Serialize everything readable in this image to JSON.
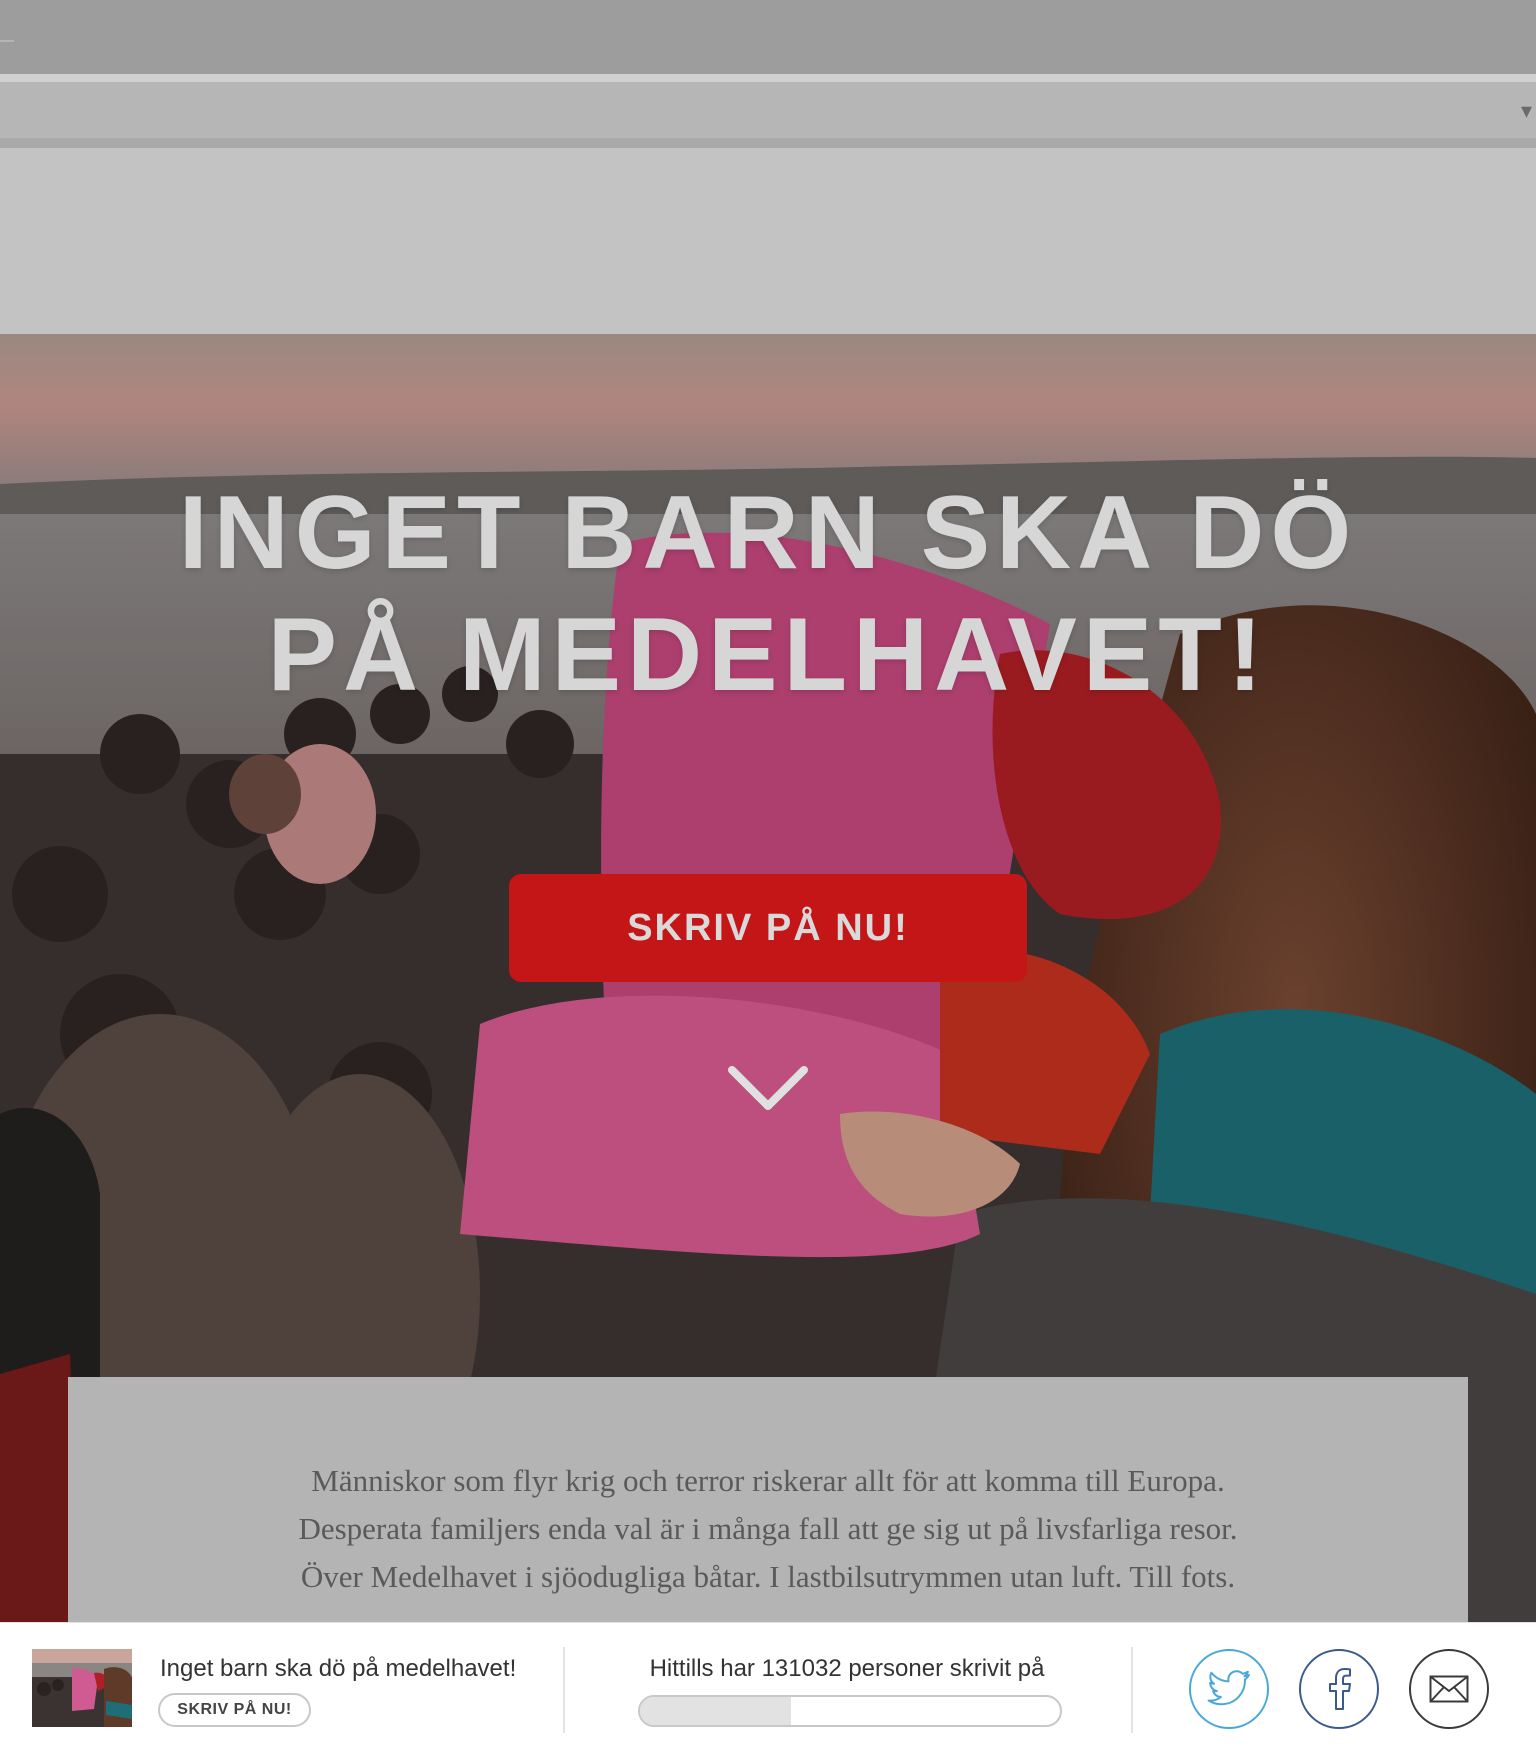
{
  "hero": {
    "title_line1": "INGET BARN SKA DÖ",
    "title_line2": "PÅ MEDELHAVET!",
    "cta_label": "SKRIV PÅ NU!"
  },
  "intro": {
    "lines": [
      "Människor som flyr krig och terror riskerar allt för att komma till Europa.",
      "Desperata familjers enda val är i många fall att ge sig ut på livsfarliga resor.",
      "Över Medelhavet i sjöodugliga båtar. I lastbilsutrymmen utan luft. Till fots."
    ]
  },
  "footer": {
    "title": "Inget barn ska dö på medelhavet!",
    "cta_label": "SKRIV PÅ NU!",
    "counter_text": "Hittills har 131032 personer skrivit på",
    "progress_fraction": 0.36,
    "share": {
      "twitter_icon": "twitter-icon",
      "facebook_icon": "facebook-icon",
      "mail_icon": "mail-icon"
    }
  },
  "colors": {
    "cta_red": "#c41517",
    "twitter_blue": "#4aa8d8",
    "facebook_blue": "#3b5a8c"
  }
}
